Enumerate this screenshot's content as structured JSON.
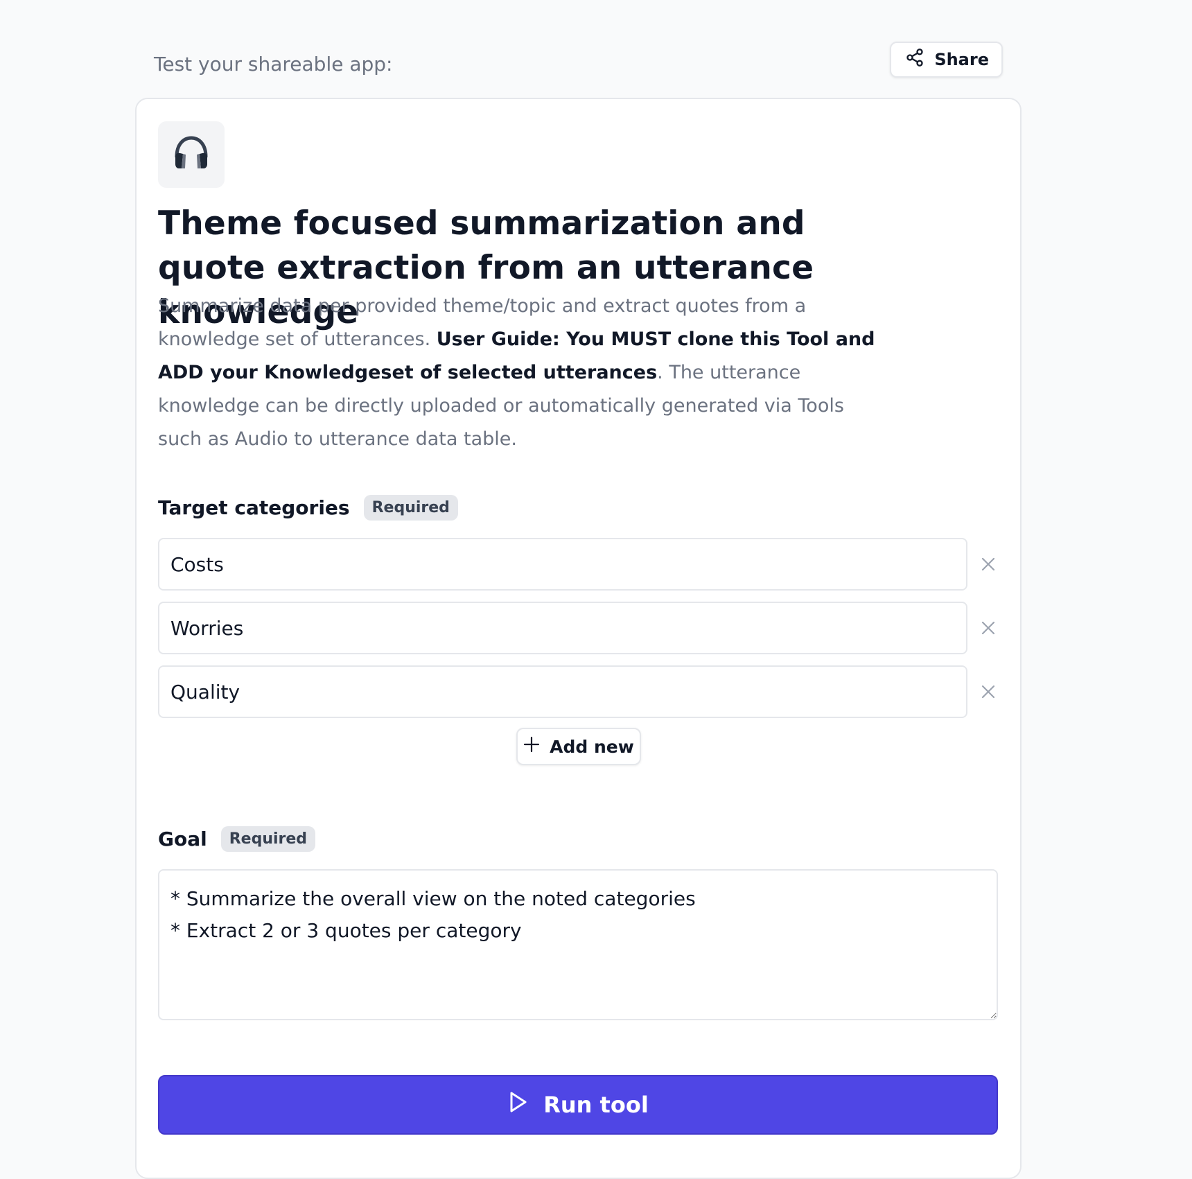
{
  "header": {
    "label": "Test your shareable app:",
    "share_label": "Share"
  },
  "app": {
    "icon": "headphones-icon",
    "title": "Theme focused summarization and quote extraction from an utterance knowledge",
    "description": {
      "part1": "Summarize data per provided theme/topic and extract quotes from a knowledge set of utterances. ",
      "bold": "User Guide: You MUST clone this Tool and ADD your Knowledgeset of selected utterances",
      "part2": ". The utterance knowledge can be directly uploaded or automatically generated via Tools such as Audio to utterance data table."
    }
  },
  "target_categories": {
    "label": "Target categories",
    "badge": "Required",
    "items": [
      "Costs",
      "Worries",
      "Quality"
    ],
    "add_label": "Add new"
  },
  "goal": {
    "label": "Goal",
    "badge": "Required",
    "value": "* Summarize the overall view on the noted categories\n* Extract 2 or 3 quotes per category"
  },
  "run": {
    "label": "Run tool"
  },
  "colors": {
    "accent": "#4f46e5",
    "background": "#f9fafb",
    "muted_text": "#6b7280"
  }
}
